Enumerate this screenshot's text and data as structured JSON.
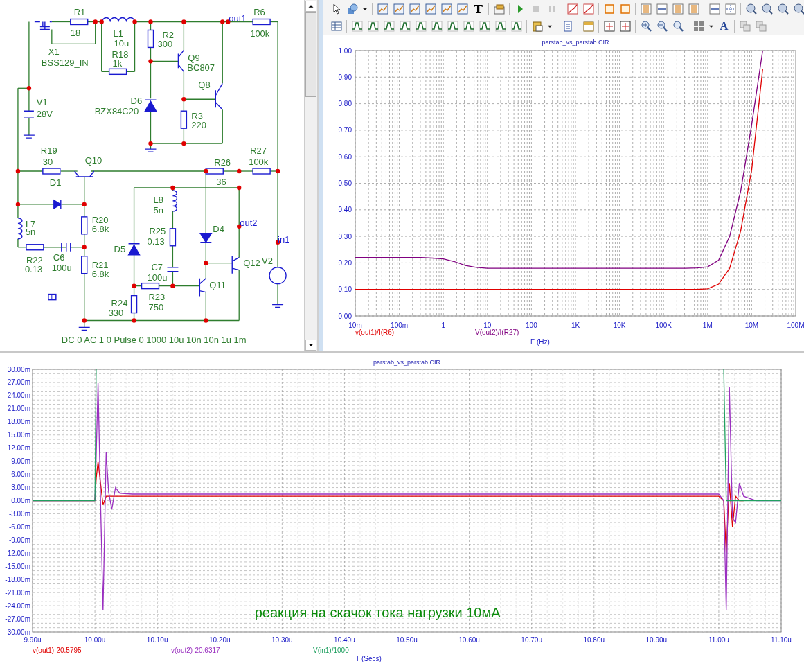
{
  "schematic": {
    "labels": [
      {
        "text": "R1",
        "kind": "part"
      },
      {
        "text": "18",
        "kind": "part"
      },
      {
        "text": "L1",
        "kind": "part"
      },
      {
        "text": "10u",
        "kind": "part"
      },
      {
        "text": "R18",
        "kind": "part"
      },
      {
        "text": "1k",
        "kind": "part"
      },
      {
        "text": "X1",
        "kind": "part"
      },
      {
        "text": "BSS129_IN",
        "kind": "part"
      },
      {
        "text": "R2",
        "kind": "part"
      },
      {
        "text": "300",
        "kind": "part"
      },
      {
        "text": "Q9",
        "kind": "part"
      },
      {
        "text": "BC807",
        "kind": "part"
      },
      {
        "text": "out1",
        "kind": "node"
      },
      {
        "text": "R6",
        "kind": "part"
      },
      {
        "text": "100k",
        "kind": "part"
      },
      {
        "text": "V1",
        "kind": "part"
      },
      {
        "text": "28V",
        "kind": "part"
      },
      {
        "text": "Q8",
        "kind": "part"
      },
      {
        "text": "D6",
        "kind": "part"
      },
      {
        "text": "BZX84C20",
        "kind": "part"
      },
      {
        "text": "R3",
        "kind": "part"
      },
      {
        "text": "220",
        "kind": "part"
      },
      {
        "text": "R19",
        "kind": "part"
      },
      {
        "text": "30",
        "kind": "part"
      },
      {
        "text": "Q10",
        "kind": "part"
      },
      {
        "text": "R26",
        "kind": "part"
      },
      {
        "text": "R27",
        "kind": "part"
      },
      {
        "text": "100k",
        "kind": "part"
      },
      {
        "text": "D1",
        "kind": "part"
      },
      {
        "text": "36",
        "kind": "part"
      },
      {
        "text": "L8",
        "kind": "part"
      },
      {
        "text": "5n",
        "kind": "part"
      },
      {
        "text": "R20",
        "kind": "part"
      },
      {
        "text": "6.8k",
        "kind": "part"
      },
      {
        "text": "L7",
        "kind": "part"
      },
      {
        "text": "5n",
        "kind": "part"
      },
      {
        "text": "out2",
        "kind": "node"
      },
      {
        "text": "R25",
        "kind": "part"
      },
      {
        "text": "D4",
        "kind": "part"
      },
      {
        "text": "0.13",
        "kind": "part"
      },
      {
        "text": "in1",
        "kind": "node"
      },
      {
        "text": "D5",
        "kind": "part"
      },
      {
        "text": "C6",
        "kind": "part"
      },
      {
        "text": "R22",
        "kind": "part"
      },
      {
        "text": "Q12",
        "kind": "part"
      },
      {
        "text": "V2",
        "kind": "part"
      },
      {
        "text": "0.13",
        "kind": "part"
      },
      {
        "text": "100u",
        "kind": "part"
      },
      {
        "text": "R21",
        "kind": "part"
      },
      {
        "text": "C7",
        "kind": "part"
      },
      {
        "text": "6.8k",
        "kind": "part"
      },
      {
        "text": "100u",
        "kind": "part"
      },
      {
        "text": "Q11",
        "kind": "part"
      },
      {
        "text": "R23",
        "kind": "part"
      },
      {
        "text": "R24",
        "kind": "part"
      },
      {
        "text": "750",
        "kind": "part"
      },
      {
        "text": "330",
        "kind": "part"
      }
    ],
    "source_text": "DC 0 AC 1 0 Pulse 0 1000 10u 10n 10n 1u 1m"
  },
  "toolbar": {
    "letters": [
      "T",
      "A"
    ]
  },
  "ac_plot": {
    "chart_data": {
      "type": "line",
      "title": "parstab_vs_parstab.CIR",
      "xlabel": "F (Hz)",
      "categories": [
        "10m",
        null,
        null,
        null,
        "100m",
        null,
        null,
        null,
        "1",
        null,
        null,
        null,
        "10",
        null,
        null,
        null,
        "100",
        null,
        null,
        null,
        "1K",
        null,
        null,
        null,
        "10K",
        null,
        null,
        null,
        "100K",
        null,
        null,
        null,
        "1M",
        null,
        null,
        null,
        "10M",
        null,
        null,
        null,
        "100M"
      ],
      "series": [
        {
          "name": "v(out1)/I(R6)",
          "color": "#e00000",
          "values": [
            0.1,
            0.1,
            0.1,
            0.1,
            0.1,
            0.1,
            0.1,
            0.1,
            0.1,
            0.1,
            0.1,
            0.1,
            0.1,
            0.1,
            0.1,
            0.1,
            0.1,
            0.1,
            0.1,
            0.1,
            0.1,
            0.1,
            0.1,
            0.1,
            0.1,
            0.1,
            0.1,
            0.1,
            0.1,
            0.1,
            0.1,
            0.1,
            0.102,
            0.12,
            0.18,
            0.32,
            0.55,
            0.93,
            null,
            null,
            null
          ]
        },
        {
          "name": "V(out2)/I(R27)",
          "color": "#800080",
          "values": [
            0.22,
            0.22,
            0.22,
            0.22,
            0.22,
            0.22,
            0.22,
            0.218,
            0.215,
            0.205,
            0.19,
            0.183,
            0.18,
            0.18,
            0.18,
            0.18,
            0.18,
            0.18,
            0.18,
            0.18,
            0.18,
            0.18,
            0.18,
            0.18,
            0.18,
            0.18,
            0.18,
            0.18,
            0.18,
            0.18,
            0.18,
            0.181,
            0.185,
            0.21,
            0.3,
            0.47,
            0.72,
            1.0,
            null,
            null,
            null
          ]
        }
      ],
      "ylim": [
        0,
        1
      ],
      "grid": true,
      "yticks": [
        {
          "value": 0,
          "label": "0.00"
        },
        {
          "value": 0.1,
          "label": "0.10"
        },
        {
          "value": 0.2,
          "label": "0.20"
        },
        {
          "value": 0.3,
          "label": "0.30"
        },
        {
          "value": 0.4,
          "label": "0.40"
        },
        {
          "value": 0.5,
          "label": "0.50"
        },
        {
          "value": 0.6,
          "label": "0.60"
        },
        {
          "value": 0.7,
          "label": "0.70"
        },
        {
          "value": 0.8,
          "label": "0.80"
        },
        {
          "value": 0.9,
          "label": "0.90"
        },
        {
          "value": 1,
          "label": "1.00"
        }
      ]
    }
  },
  "transient_plot": {
    "chart_data": {
      "type": "line",
      "title": "parstab_vs_parstab.CIR",
      "xlabel": "T (Secs)",
      "x": [
        9.9,
        10.0,
        10.002,
        10.005,
        10.009,
        10.013,
        10.018,
        10.022,
        10.027,
        10.033,
        10.04,
        10.06,
        11.0,
        11.008,
        11.012,
        11.017,
        11.022,
        11.027,
        11.033,
        11.04,
        11.06,
        11.1
      ],
      "series": [
        {
          "name": "v(out1)-20.5795",
          "color": "#e00000",
          "values": [
            0,
            0,
            5,
            9,
            4,
            -1,
            1,
            1,
            1,
            1,
            1,
            1,
            1,
            0,
            -12,
            4,
            -6,
            1,
            0,
            0,
            null,
            null
          ]
        },
        {
          "name": "v(out2)-20.6317",
          "color": "#9a30c0",
          "values": [
            0,
            0,
            10,
            27,
            0,
            -25,
            11,
            2,
            -2,
            3,
            1.7,
            1.5,
            1.5,
            0,
            -25,
            26,
            -4,
            -5,
            4,
            1,
            0,
            0
          ]
        },
        {
          "name": "V(in1)/1000",
          "color": "#20a060",
          "values": [
            0,
            0,
            30,
            null,
            null,
            null,
            null,
            null,
            null,
            null,
            null,
            null,
            null,
            30,
            0,
            0,
            0,
            0,
            0,
            0,
            0,
            0
          ]
        }
      ],
      "xlim": [
        9.9,
        11.1
      ],
      "ylim": [
        -30,
        30
      ],
      "grid": true,
      "xticks": [
        {
          "value": 9.9,
          "label": "9.90u"
        },
        {
          "value": 10.0,
          "label": "10.00u"
        },
        {
          "value": 10.1,
          "label": "10.10u"
        },
        {
          "value": 10.2,
          "label": "10.20u"
        },
        {
          "value": 10.3,
          "label": "10.30u"
        },
        {
          "value": 10.4,
          "label": "10.40u"
        },
        {
          "value": 10.5,
          "label": "10.50u"
        },
        {
          "value": 10.6,
          "label": "10.60u"
        },
        {
          "value": 10.7,
          "label": "10.70u"
        },
        {
          "value": 10.8,
          "label": "10.80u"
        },
        {
          "value": 10.9,
          "label": "10.90u"
        },
        {
          "value": 11.0,
          "label": "11.00u"
        },
        {
          "value": 11.1,
          "label": "11.10u"
        }
      ],
      "yticks": [
        {
          "value": 30,
          "label": "30.00m"
        },
        {
          "value": 27,
          "label": "27.00m"
        },
        {
          "value": 24,
          "label": "24.00m"
        },
        {
          "value": 21,
          "label": "21.00m"
        },
        {
          "value": 18,
          "label": "18.00m"
        },
        {
          "value": 15,
          "label": "15.00m"
        },
        {
          "value": 12,
          "label": "12.00m"
        },
        {
          "value": 9,
          "label": "9.00m"
        },
        {
          "value": 6,
          "label": "6.00m"
        },
        {
          "value": 3,
          "label": "3.00m"
        },
        {
          "value": 0,
          "label": "0.00m"
        },
        {
          "value": -3,
          "label": "-3.00m"
        },
        {
          "value": -6,
          "label": "-6.00m"
        },
        {
          "value": -9,
          "label": "-9.00m"
        },
        {
          "value": -12,
          "label": "-12.00m"
        },
        {
          "value": -15,
          "label": "-15.00m"
        },
        {
          "value": -18,
          "label": "-18.00m"
        },
        {
          "value": -21,
          "label": "-21.00m"
        },
        {
          "value": -24,
          "label": "-24.00m"
        },
        {
          "value": -27,
          "label": "-27.00m"
        },
        {
          "value": -30,
          "label": "-30.00m"
        }
      ],
      "annotations": [
        "реакция на скачок тока нагрузки 10мА"
      ]
    }
  }
}
